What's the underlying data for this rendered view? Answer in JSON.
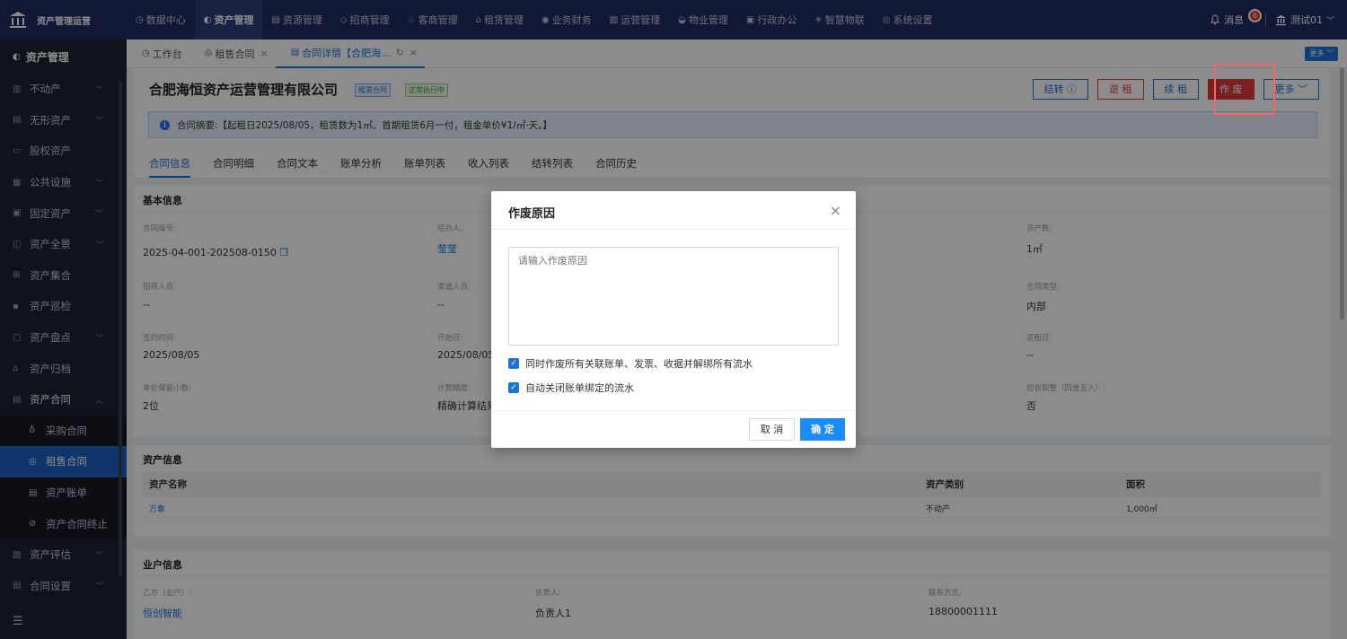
{
  "app": {
    "title": "资产管理运营"
  },
  "topnav": [
    {
      "label": "数据中心",
      "icon": "◷"
    },
    {
      "label": "资产管理",
      "icon": "◐"
    },
    {
      "label": "资源管理",
      "icon": "▤"
    },
    {
      "label": "招商管理",
      "icon": "◇"
    },
    {
      "label": "客商管理",
      "icon": "♧"
    },
    {
      "label": "租赁管理",
      "icon": "⌂"
    },
    {
      "label": "业务财务",
      "icon": "◉"
    },
    {
      "label": "运营管理",
      "icon": "▨"
    },
    {
      "label": "物业管理",
      "icon": "◒"
    },
    {
      "label": "行政办公",
      "icon": "▣"
    },
    {
      "label": "智慧物联",
      "icon": "✳"
    },
    {
      "label": "系统设置",
      "icon": "◎"
    }
  ],
  "user": {
    "messages_label": "消息",
    "messages_count": "6",
    "name": "测试01"
  },
  "sidebar": {
    "title": "资产管理",
    "items": [
      {
        "label": "不动产",
        "icon": "▥",
        "chev": "﹀"
      },
      {
        "label": "无形资产",
        "icon": "▤",
        "chev": "﹀"
      },
      {
        "label": "股权资产",
        "icon": "▭",
        "chev": ""
      },
      {
        "label": "公共设施",
        "icon": "▦",
        "chev": "﹀"
      },
      {
        "label": "固定资产",
        "icon": "▣",
        "chev": "﹀"
      },
      {
        "label": "资产全景",
        "icon": "◫",
        "chev": "﹀"
      },
      {
        "label": "资产集合",
        "icon": "⊞",
        "chev": ""
      },
      {
        "label": "资产巡检",
        "icon": "▪",
        "chev": ""
      },
      {
        "label": "资产盘点",
        "icon": "▢",
        "chev": "﹀"
      },
      {
        "label": "资产归档",
        "icon": "⌂",
        "chev": ""
      },
      {
        "label": "资产合同",
        "icon": "▤",
        "chev": "︿"
      }
    ],
    "subitems": [
      {
        "label": "采购合同",
        "icon": "♁"
      },
      {
        "label": "租售合同",
        "icon": "◎"
      },
      {
        "label": "资产账单",
        "icon": "▤"
      },
      {
        "label": "资产合同终止",
        "icon": "⊘"
      }
    ],
    "items2": [
      {
        "label": "资产评估",
        "icon": "▧",
        "chev": "﹀"
      },
      {
        "label": "合同设置",
        "icon": "▤",
        "chev": "﹀"
      }
    ]
  },
  "tabs": [
    {
      "label": "工作台",
      "icon": "◷"
    },
    {
      "label": "租售合同",
      "icon": "◎"
    },
    {
      "label": "合同详情【合肥海...",
      "icon": "▤"
    }
  ],
  "tab_more": "更多",
  "header": {
    "company": "合肥海恒资产运营管理有限公司",
    "tag1": "租赁合同",
    "tag2": "正常执行中",
    "btn_transfer": "结转 ⓘ",
    "btn_withdraw": "退 租",
    "btn_renew": "续 租",
    "btn_void": "作 废",
    "btn_more": "更多 ﹀",
    "summary": "合同摘要:【起租日2025/08/05，租赁数为1㎡。首期租赁6月一付，租金单价¥1/㎡·天。】"
  },
  "detail_tabs": [
    "合同信息",
    "合同明细",
    "合同文本",
    "账单分析",
    "账单列表",
    "收入列表",
    "结转列表",
    "合同历史"
  ],
  "basic": {
    "title": "基本信息",
    "contract_no_label": "合同编号:",
    "contract_no": "2025-04-001-202508-0150",
    "handler_label": "经办人:",
    "handler": "莹莹",
    "asset_count_label": "资产数:",
    "asset_count": "1㎡",
    "recruiter_label": "招商人员:",
    "recruiter": "--",
    "channel_label": "渠道人员:",
    "channel": "--",
    "contract_type_label": "合同类型:",
    "contract_type": "内部",
    "sign_label": "签约时间:",
    "sign": "2025/08/05",
    "start_label": "开始日:",
    "start": "2025/08/05",
    "withdraw_label": "退租日:",
    "withdraw": "--",
    "decimal_label": "单价保留小数:",
    "decimal": "2位",
    "precision_label": "计算精度:",
    "precision": "精确计算结果",
    "rounding_label": "应收取整（四舍五入）:",
    "rounding": "否"
  },
  "assets": {
    "title": "资产信息",
    "headers": [
      "资产名称",
      "资产类别",
      "面积"
    ],
    "rows": [
      [
        "万象",
        "不动产",
        "1,000㎡"
      ]
    ]
  },
  "owner": {
    "title": "业户信息",
    "party_label": "乙方（业户）:",
    "party": "恒创智能",
    "person_label": "负责人:",
    "person": "负责人1",
    "contact_label": "联系方式:",
    "contact": "18800001111"
  },
  "modal": {
    "title": "作废原因",
    "placeholder": "请输入作废原因",
    "check1": "同时作废所有关联账单、发票、收据并解绑所有流水",
    "check2": "自动关闭账单绑定的流水",
    "cancel": "取 消",
    "ok": "确 定"
  }
}
